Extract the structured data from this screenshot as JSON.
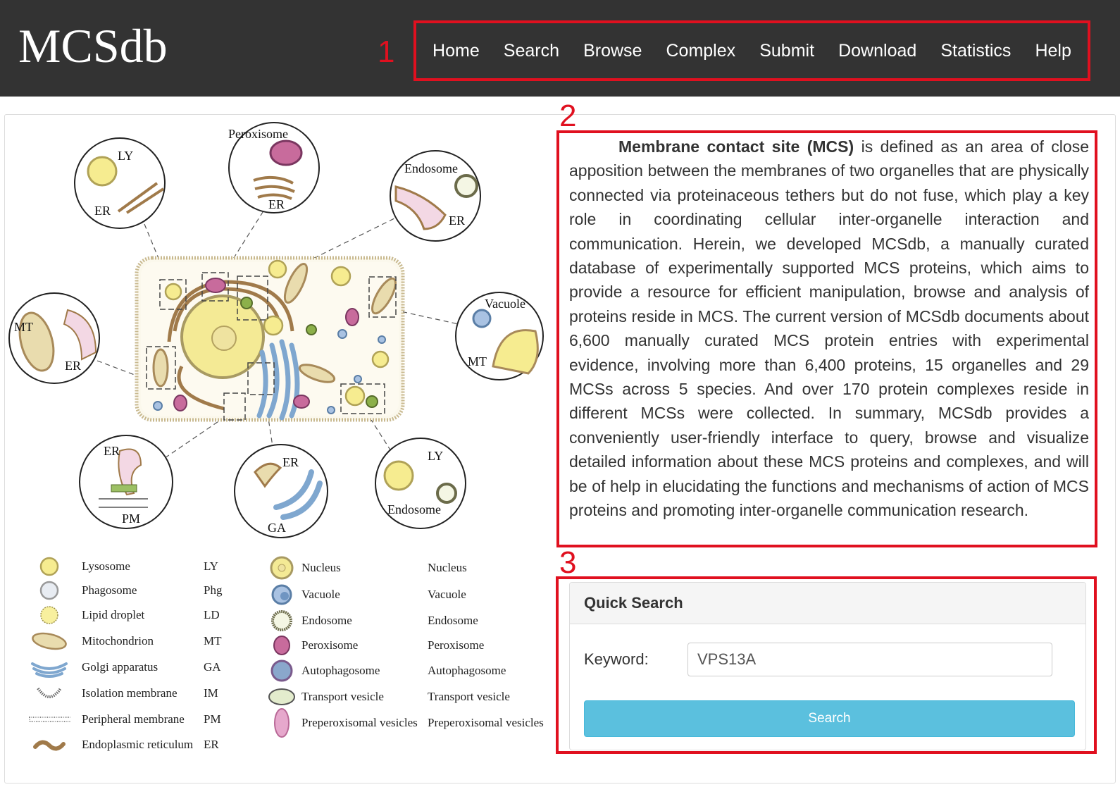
{
  "header": {
    "logo": "MCSdb",
    "nav": [
      "Home",
      "Search",
      "Browse",
      "Complex",
      "Submit",
      "Download",
      "Statistics",
      "Help"
    ]
  },
  "annotations": [
    "1",
    "2",
    "3"
  ],
  "diagram": {
    "labels": {
      "ly_top": "LY",
      "er_ly": "ER",
      "peroxisome": "Peroxisome",
      "er_px": "ER",
      "endosome_top": "Endosome",
      "er_en": "ER",
      "mt_left": "MT",
      "er_mt": "ER",
      "vacuole": "Vacuole",
      "mt_vac": "MT",
      "er_pm": "ER",
      "pm": "PM",
      "er_ga": "ER",
      "ga": "GA",
      "ly_bot": "LY",
      "endosome_bot": "Endosome"
    }
  },
  "legend": {
    "left": [
      {
        "name": "Lysosome",
        "abbr": "LY",
        "icon": "lysosome-icon"
      },
      {
        "name": "Phagosome",
        "abbr": "Phg",
        "icon": "phagosome-icon"
      },
      {
        "name": "Lipid droplet",
        "abbr": "LD",
        "icon": "lipid-droplet-icon"
      },
      {
        "name": "Mitochondrion",
        "abbr": "MT",
        "icon": "mitochondrion-icon"
      },
      {
        "name": "Golgi apparatus",
        "abbr": "GA",
        "icon": "golgi-icon"
      },
      {
        "name": "Isolation membrane",
        "abbr": "IM",
        "icon": "isolation-membrane-icon"
      },
      {
        "name": "Peripheral membrane",
        "abbr": "PM",
        "icon": "peripheral-membrane-icon"
      },
      {
        "name": "Endoplasmic reticulum",
        "abbr": "ER",
        "icon": "er-icon"
      }
    ],
    "right": [
      {
        "name": "Nucleus",
        "abbr": "Nucleus",
        "icon": "nucleus-icon"
      },
      {
        "name": "Vacuole",
        "abbr": "Vacuole",
        "icon": "vacuole-icon"
      },
      {
        "name": "Endosome",
        "abbr": "Endosome",
        "icon": "endosome-icon"
      },
      {
        "name": "Peroxisome",
        "abbr": "Peroxisome",
        "icon": "peroxisome-icon"
      },
      {
        "name": "Autophagosome",
        "abbr": "Autophagosome",
        "icon": "autophagosome-icon"
      },
      {
        "name": "Transport vesicle",
        "abbr": "Transport vesicle",
        "icon": "transport-vesicle-icon"
      },
      {
        "name": "Preperoxisomal vesicles",
        "abbr": "Preperoxisomal vesicles",
        "icon": "preperoxisomal-vesicle-icon"
      }
    ]
  },
  "intro": {
    "bold": "Membrane contact site (MCS)",
    "text": " is defined as an area of close apposition between the membranes of two organelles that are physically connected via proteinaceous tethers but do not fuse, which play a key role in coordinating cellular inter-organelle interaction and communication. Herein, we developed MCSdb, a manually curated database of experimentally supported MCS proteins, which aims to provide a resource for efficient manipulation, browse and analysis of proteins reside in MCS. The current version of MCSdb documents about 6,600 manually curated MCS protein entries with experimental evidence, involving more than 6,400 proteins, 15 organelles and 29 MCSs across 5 species. And over 170 protein complexes reside in different MCSs were collected. In summary, MCSdb provides a conveniently user-friendly interface to query, browse and visualize detailed information about these MCS proteins and complexes, and will be of help in elucidating the functions and mechanisms of action of MCS proteins and promoting inter-organelle communication research."
  },
  "quick_search": {
    "title": "Quick Search",
    "keyword_label": "Keyword:",
    "keyword_value": "VPS13A",
    "button": "Search"
  },
  "colors": {
    "header_bg": "#333333",
    "annotation_red": "#e0101f",
    "button_bg": "#5bc0de"
  }
}
